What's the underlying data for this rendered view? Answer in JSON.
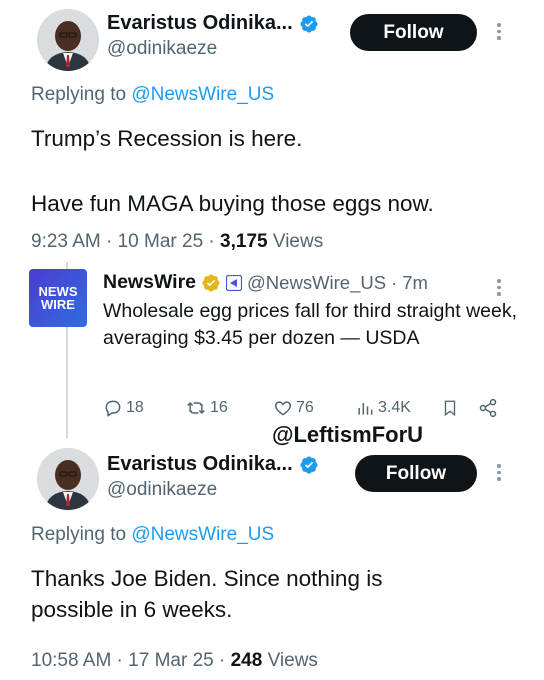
{
  "tweet1": {
    "author_name": "Evaristus Odinika...",
    "author_handle": "@odinikaeze",
    "follow_label": "Follow",
    "replying_prefix": "Replying to ",
    "replying_handle": "@NewsWire_US",
    "text_line1": "Trump’s Recession is here.",
    "text_line2": "Have fun MAGA buying those eggs now.",
    "time": "9:23 AM",
    "date": "10 Mar 25",
    "views_count": "3,175",
    "views_label": "Views"
  },
  "quoted": {
    "logo_line1": "NEWS",
    "logo_line2": "WIRE",
    "author_name": "NewsWire",
    "author_handle": "@NewsWire_US",
    "age": "7m",
    "text": "Wholesale egg prices fall for third straight week, averaging $3.45 per dozen — USDA",
    "replies": "18",
    "reposts": "16",
    "likes": "76",
    "views": "3.4K"
  },
  "watermark": "@LeftismForU",
  "tweet2": {
    "author_name": "Evaristus Odinika...",
    "author_handle": "@odinikaeze",
    "follow_label": "Follow",
    "replying_prefix": "Replying to ",
    "replying_handle": "@NewsWire_US",
    "text": "Thanks Joe Biden. Since nothing is possible in 6 weeks.",
    "time": "10:58 AM",
    "date": "17 Mar 25",
    "views_count": "248",
    "views_label": "Views"
  },
  "colors": {
    "verified_blue": "#1d9bf0",
    "verified_gold": "#e2b719",
    "link": "#1d9bf0",
    "muted": "#536471"
  }
}
